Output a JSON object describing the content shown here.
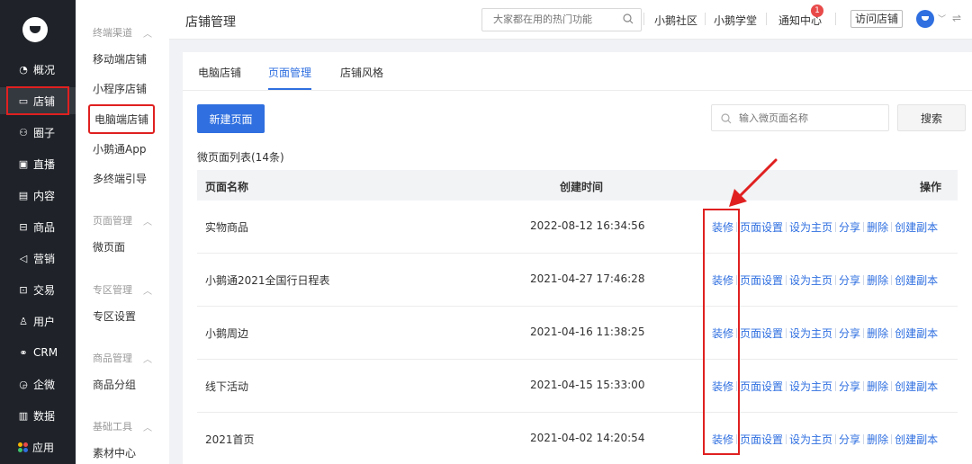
{
  "nav": {
    "items": [
      {
        "label": "概况",
        "icon": "pie-chart-icon",
        "glyph": "◔"
      },
      {
        "label": "店铺",
        "icon": "store-icon",
        "glyph": "▭"
      },
      {
        "label": "圈子",
        "icon": "community-icon",
        "glyph": "⚇"
      },
      {
        "label": "直播",
        "icon": "live-icon",
        "glyph": "▣"
      },
      {
        "label": "内容",
        "icon": "content-icon",
        "glyph": "▤"
      },
      {
        "label": "商品",
        "icon": "goods-icon",
        "glyph": "⊟"
      },
      {
        "label": "营销",
        "icon": "marketing-icon",
        "glyph": "◁"
      },
      {
        "label": "交易",
        "icon": "trade-icon",
        "glyph": "⊡"
      },
      {
        "label": "用户",
        "icon": "user-icon",
        "glyph": "♙"
      },
      {
        "label": "CRM",
        "icon": "crm-icon",
        "glyph": "⚭"
      },
      {
        "label": "企微",
        "icon": "wecom-icon",
        "glyph": "◶"
      },
      {
        "label": "数据",
        "icon": "data-icon",
        "glyph": "▥"
      },
      {
        "label": "应用",
        "icon": "apps-icon",
        "glyph": ""
      }
    ],
    "active": "店铺",
    "app_dot_colors": [
      "#f5b400",
      "#e84a4a",
      "#3ec46d",
      "#2f6fe0"
    ]
  },
  "submenu": {
    "groups": [
      {
        "label": "终端渠道",
        "items": [
          "移动端店铺",
          "小程序店铺",
          "电脑端店铺",
          "小鹅通App",
          "多终端引导"
        ]
      },
      {
        "label": "页面管理",
        "items": [
          "微页面"
        ]
      },
      {
        "label": "专区管理",
        "items": [
          "专区设置"
        ]
      },
      {
        "label": "商品管理",
        "items": [
          "商品分组"
        ]
      },
      {
        "label": "基础工具",
        "items": [
          "素材中心"
        ]
      }
    ],
    "current": "电脑端店铺"
  },
  "header": {
    "title": "店铺管理",
    "search_placeholder": "大家都在用的热门功能",
    "links": [
      "小鹅社区",
      "小鹅学堂",
      "通知中心"
    ],
    "notify_badge": "1",
    "visit_label": "访问店铺"
  },
  "tabs": [
    "电脑店铺",
    "页面管理",
    "店铺风格"
  ],
  "active_tab": "页面管理",
  "toolbar": {
    "new_page_label": "新建页面",
    "search_placeholder": "输入微页面名称",
    "search_label": "搜索"
  },
  "list": {
    "title": "微页面列表(14条)",
    "columns": [
      "页面名称",
      "创建时间",
      "操作"
    ],
    "rows": [
      {
        "name": "实物商品",
        "created": "2022-08-12 16:34:56"
      },
      {
        "name": "小鹅通2021全国行日程表",
        "created": "2021-04-27 17:46:28"
      },
      {
        "name": "小鹅周边",
        "created": "2021-04-16 11:38:25"
      },
      {
        "name": "线下活动",
        "created": "2021-04-15 15:33:00"
      },
      {
        "name": "2021首页",
        "created": "2021-04-02 14:20:54"
      }
    ],
    "actions": [
      "装修",
      "页面设置",
      "设为主页",
      "分享",
      "删除",
      "创建副本"
    ]
  },
  "colors": {
    "accent": "#2f6fe0",
    "nav_bg": "#1f2329",
    "highlight": "#e02020"
  }
}
